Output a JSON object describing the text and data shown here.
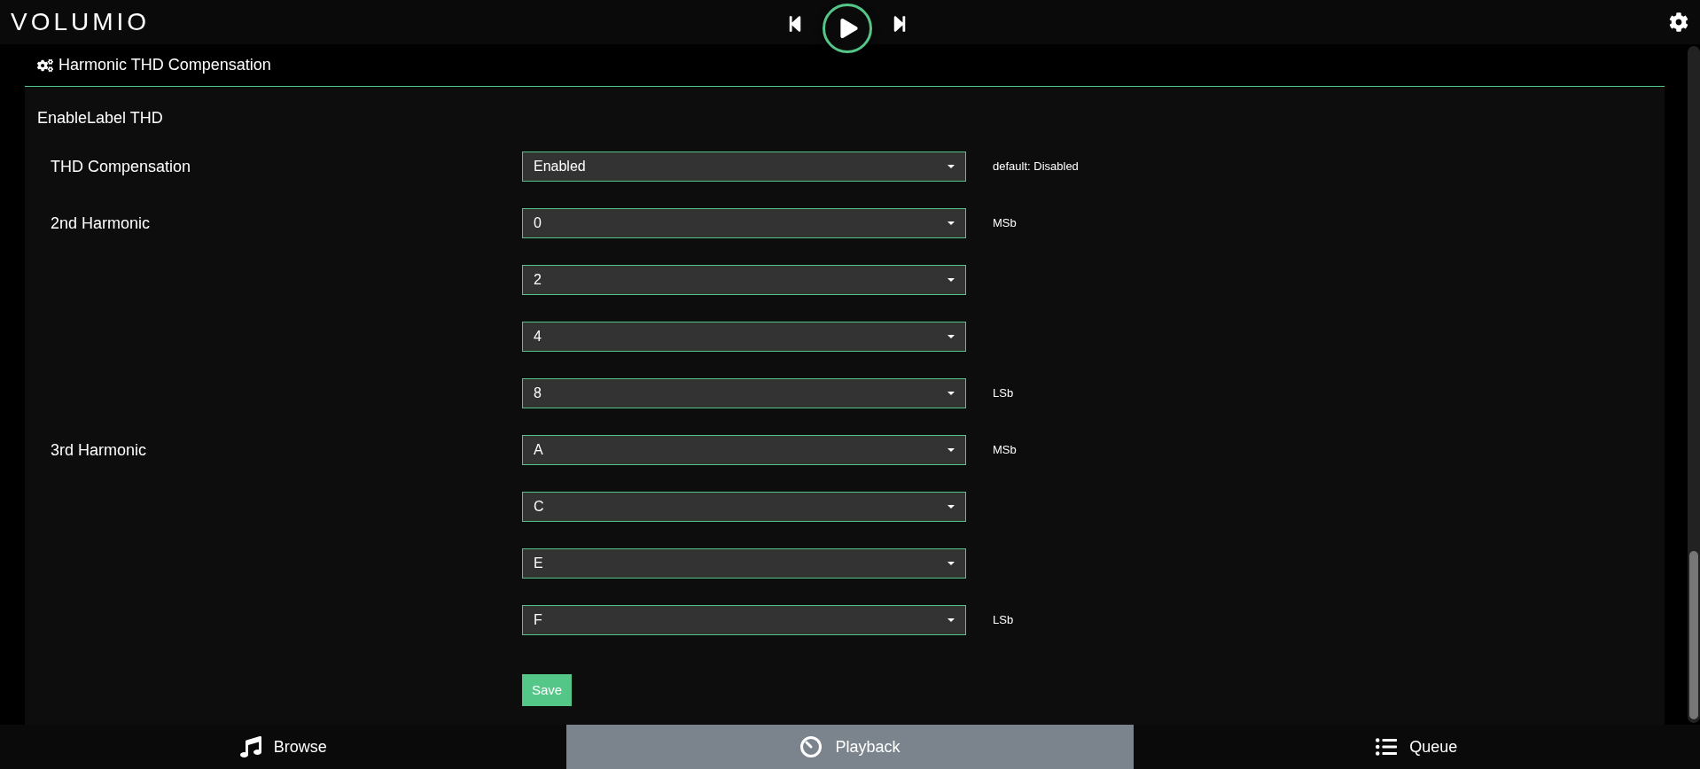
{
  "header": {
    "logo": "VOLUMIO"
  },
  "section": {
    "title": "Harmonic THD Compensation",
    "subtitle": "EnableLabel THD",
    "settings": [
      {
        "label": "THD Compensation",
        "fields": [
          {
            "value": "Enabled",
            "note": "default: Disabled"
          }
        ]
      },
      {
        "label": "2nd Harmonic",
        "fields": [
          {
            "value": "0",
            "note": "MSb"
          },
          {
            "value": "2"
          },
          {
            "value": "4"
          },
          {
            "value": "8",
            "note": "LSb"
          }
        ]
      },
      {
        "label": "3rd Harmonic",
        "fields": [
          {
            "value": "A",
            "note": "MSb"
          },
          {
            "value": "C"
          },
          {
            "value": "E"
          },
          {
            "value": "F",
            "note": "LSb"
          }
        ]
      }
    ],
    "save": "Save"
  },
  "tabs": [
    {
      "kind": "browse",
      "label": "Browse",
      "selected": false
    },
    {
      "kind": "playback",
      "label": "Playback",
      "selected": true
    },
    {
      "kind": "queue",
      "label": "Queue",
      "selected": false
    }
  ]
}
